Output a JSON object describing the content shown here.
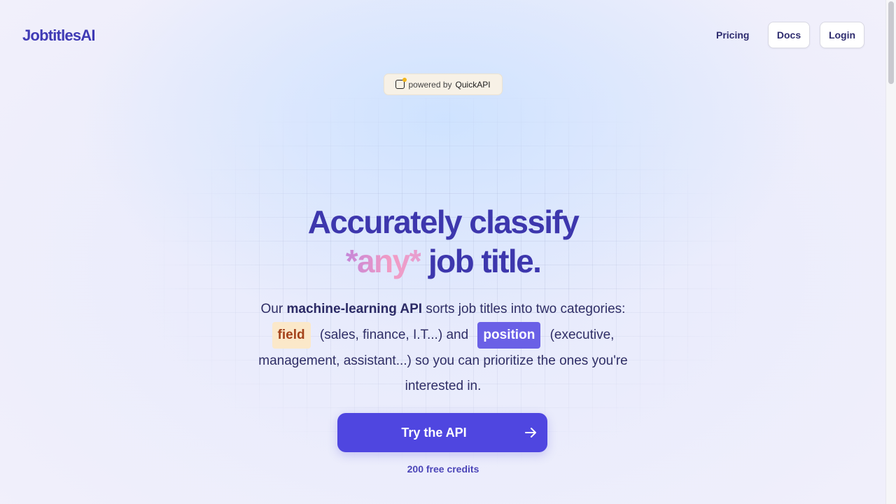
{
  "brand": {
    "logo": "JobtitlesAI"
  },
  "nav": {
    "pricing": "Pricing",
    "docs": "Docs",
    "login": "Login"
  },
  "badge": {
    "prefix": "powered by",
    "name": "QuickAPI"
  },
  "hero": {
    "line1": "Accurately classify",
    "any": "*any*",
    "line2_rest": " job title.",
    "desc_intro": "Our ",
    "desc_bold": "machine-learning API",
    "desc_after_bold": " sorts job titles into two categories: ",
    "field_label": "field",
    "field_examples": " (sales, finance, I.T...) and ",
    "position_label": "position",
    "position_examples": " (executive, management, assistant...) so you can prioritize the ones you're interested in."
  },
  "cta": {
    "label": "Try the API",
    "subtext": "200 free credits"
  },
  "colors": {
    "brand": "#3f3ab5",
    "cta": "#4f46e0",
    "field_bg": "#fbe8c9",
    "field_text": "#a4421a",
    "position_bg": "#6a60e6"
  },
  "icons": {
    "badge": "quickapi-logo-icon",
    "cta": "arrow-right-icon"
  }
}
